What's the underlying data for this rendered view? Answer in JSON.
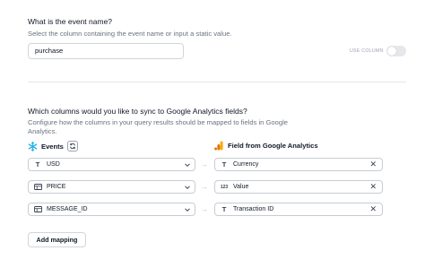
{
  "event_name": {
    "title": "What is the event name?",
    "description": "Select the column containing the event name or input a static value.",
    "value": "purchase",
    "toggle_label": "USE COLUMN",
    "toggle_on": false
  },
  "sync": {
    "title": "Which columns would you like to sync to Google Analytics fields?",
    "description_line1": "Configure how the columns in your query results should be mapped to fields in Google",
    "description_line2": "Analytics.",
    "events_header": "Events",
    "ga_header": "Field from Google Analytics",
    "mappings": [
      {
        "column_type_icon": "text-type-icon",
        "column": "USD",
        "field_type_icon": "text-type-icon",
        "field": "Currency"
      },
      {
        "column_type_icon": "number-column-icon",
        "column": "PRICE",
        "field_type_icon": "number-type-icon",
        "field": "Value"
      },
      {
        "column_type_icon": "table-column-icon",
        "column": "MESSAGE_ID",
        "field_type_icon": "text-type-icon",
        "field": "Transaction ID"
      }
    ],
    "add_mapping_label": "Add mapping"
  },
  "colors": {
    "snowflake_blue": "#29b5e8",
    "ga_orange": "#f9ab00",
    "ga_dark_orange": "#e37400"
  }
}
